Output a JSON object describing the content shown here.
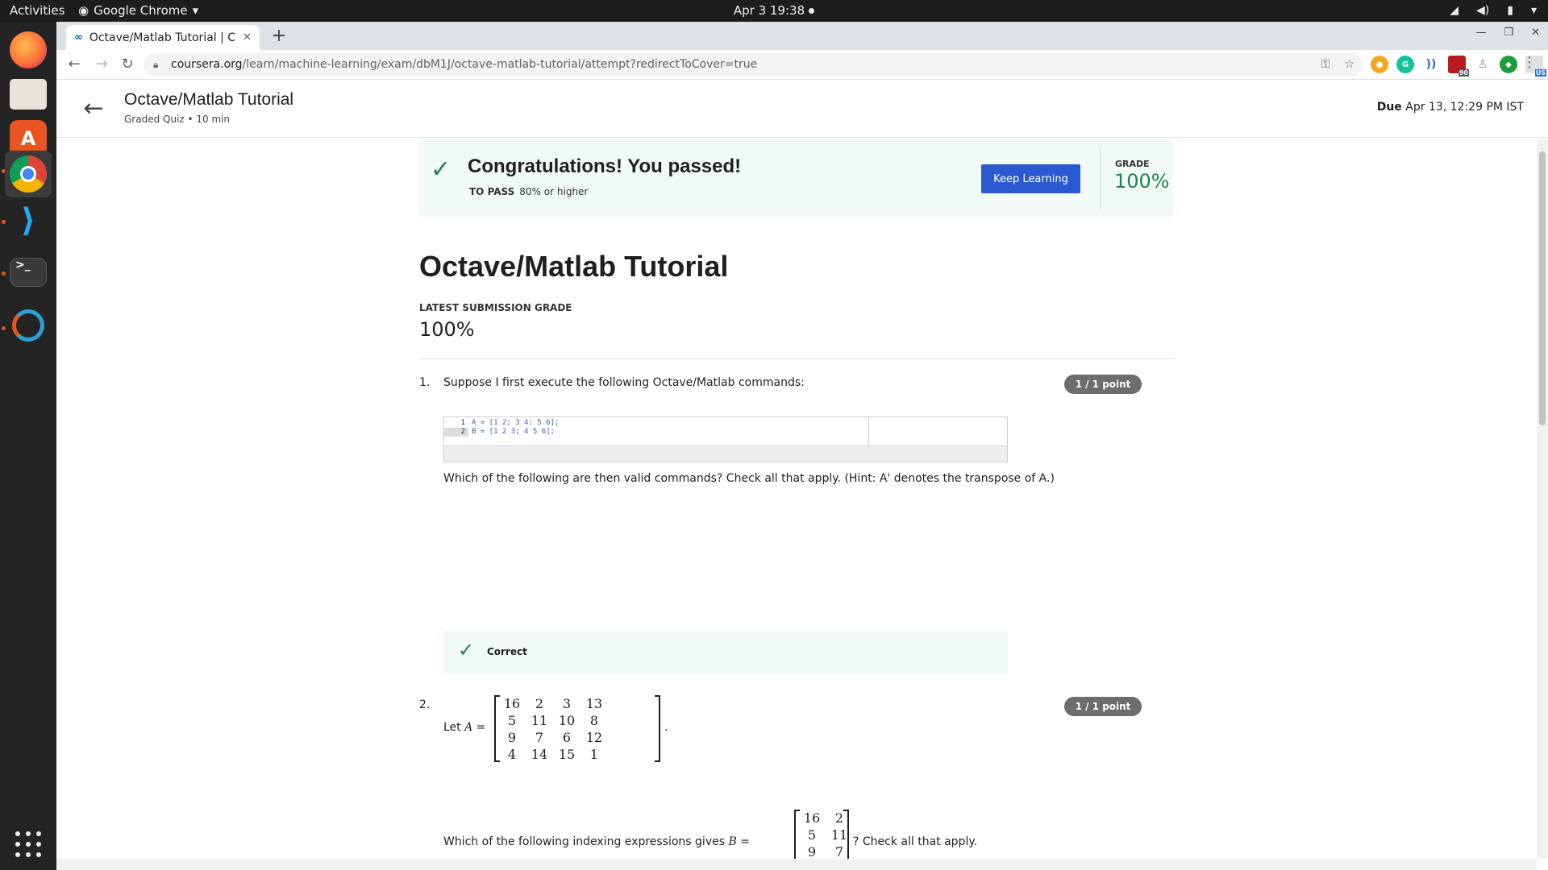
{
  "topbar": {
    "activities": "Activities",
    "app_menu": "Google Chrome",
    "clock": "Apr 3  19:38"
  },
  "browser": {
    "tab_title": "Octave/Matlab Tutorial | C",
    "url_domain": "coursera.org",
    "url_path": "/learn/machine-learning/exam/dbM1J/octave-matlab-tutorial/attempt?redirectToCover=true",
    "badge_90": "90",
    "badge_us": "US"
  },
  "header": {
    "title": "Octave/Matlab Tutorial",
    "subtitle": "Graded Quiz • 10 min",
    "due_label": "Due",
    "due_value": "Apr 13, 12:29 PM IST"
  },
  "banner": {
    "message": "Congratulations! You passed!",
    "to_pass_label": "TO PASS",
    "to_pass_value": "80% or higher",
    "button": "Keep Learning",
    "grade_label": "GRADE",
    "grade_value": "100%"
  },
  "main": {
    "title": "Octave/Matlab Tutorial",
    "latest_grade_label": "LATEST SUBMISSION GRADE",
    "latest_grade_value": "100%"
  },
  "q1": {
    "number": "1.",
    "text": "Suppose I first execute the following Octave/Matlab commands:",
    "points": "1 / 1 point",
    "code": [
      {
        "line": "1",
        "text": "A = [1 2; 3 4; 5 6];"
      },
      {
        "line": "2",
        "text": "B = [1 2 3; 4 5 6];"
      }
    ],
    "question": "Which of the following are then valid commands? Check all that apply. (Hint: A' denotes the transpose of A.)",
    "feedback": "Correct"
  },
  "q2": {
    "number": "2.",
    "let": "Let",
    "var_a": "A =",
    "points": "1 / 1 point",
    "matrix_a": [
      "16",
      "2",
      "3",
      "13",
      "5",
      "11",
      "10",
      "8",
      "9",
      "7",
      "6",
      "12",
      "4",
      "14",
      "15",
      "1"
    ],
    "period": ".",
    "question_pre": "Which of the following indexing expressions gives",
    "var_b": "B =",
    "matrix_b": [
      "16",
      "2",
      "5",
      "11",
      "9",
      "7"
    ],
    "question_post": "? Check all that apply."
  }
}
